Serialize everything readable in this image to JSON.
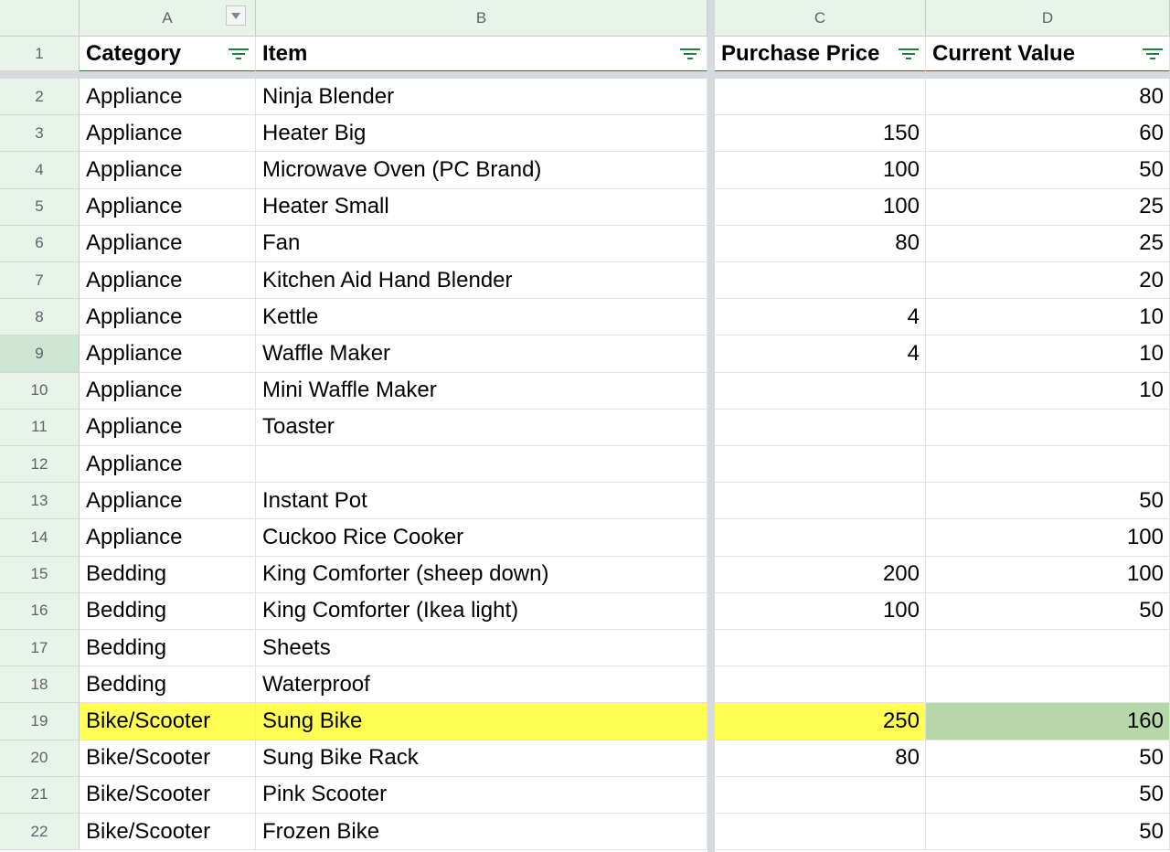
{
  "columns": [
    "A",
    "B",
    "C",
    "D"
  ],
  "header_row": {
    "number": "1",
    "cells": [
      "Category",
      "Item",
      "Purchase Price",
      "Current Value"
    ]
  },
  "rows": [
    {
      "n": "2",
      "category": "Appliance",
      "item": "Ninja Blender",
      "price": "",
      "value": "80"
    },
    {
      "n": "3",
      "category": "Appliance",
      "item": "Heater Big",
      "price": "150",
      "value": "60"
    },
    {
      "n": "4",
      "category": "Appliance",
      "item": "Microwave Oven (PC Brand)",
      "price": "100",
      "value": "50"
    },
    {
      "n": "5",
      "category": "Appliance",
      "item": "Heater Small",
      "price": "100",
      "value": "25"
    },
    {
      "n": "6",
      "category": "Appliance",
      "item": "Fan",
      "price": "80",
      "value": "25"
    },
    {
      "n": "7",
      "category": "Appliance",
      "item": "Kitchen Aid Hand Blender",
      "price": "",
      "value": "20"
    },
    {
      "n": "8",
      "category": "Appliance",
      "item": "Kettle",
      "price": "4",
      "value": "10"
    },
    {
      "n": "9",
      "category": "Appliance",
      "item": "Waffle Maker",
      "price": "4",
      "value": "10"
    },
    {
      "n": "10",
      "category": "Appliance",
      "item": "Mini Waffle Maker",
      "price": "",
      "value": "10"
    },
    {
      "n": "11",
      "category": "Appliance",
      "item": "Toaster",
      "price": "",
      "value": ""
    },
    {
      "n": "12",
      "category": "Appliance",
      "item": "",
      "price": "",
      "value": ""
    },
    {
      "n": "13",
      "category": "Appliance",
      "item": "Instant Pot",
      "price": "",
      "value": "50"
    },
    {
      "n": "14",
      "category": "Appliance",
      "item": "Cuckoo Rice Cooker",
      "price": "",
      "value": "100"
    },
    {
      "n": "15",
      "category": "Bedding",
      "item": "King Comforter (sheep down)",
      "price": "200",
      "value": "100"
    },
    {
      "n": "16",
      "category": "Bedding",
      "item": "King Comforter (Ikea light)",
      "price": "100",
      "value": "50"
    },
    {
      "n": "17",
      "category": "Bedding",
      "item": "Sheets",
      "price": "",
      "value": ""
    },
    {
      "n": "18",
      "category": "Bedding",
      "item": "Waterproof",
      "price": "",
      "value": ""
    },
    {
      "n": "19",
      "category": "Bike/Scooter",
      "item": "Sung Bike",
      "price": "250",
      "value": "160"
    },
    {
      "n": "20",
      "category": "Bike/Scooter",
      "item": "Sung Bike Rack",
      "price": "80",
      "value": "50"
    },
    {
      "n": "21",
      "category": "Bike/Scooter",
      "item": "Pink Scooter",
      "price": "",
      "value": "50"
    },
    {
      "n": "22",
      "category": "Bike/Scooter",
      "item": "Frozen Bike",
      "price": "",
      "value": "50"
    }
  ],
  "icons": {
    "filter": "filter-icon",
    "column_menu": "chevron-down-icon"
  },
  "colors": {
    "header_bg": "#e8f3ea",
    "active_row_header": "#cde5d3",
    "highlight_yellow": "#ffff54",
    "highlight_green": "#b6d7a8",
    "accent_green": "#1e7f3e"
  },
  "state": {
    "active_row": "9",
    "highlighted_row": "19",
    "highlighted_value_row": "19"
  }
}
